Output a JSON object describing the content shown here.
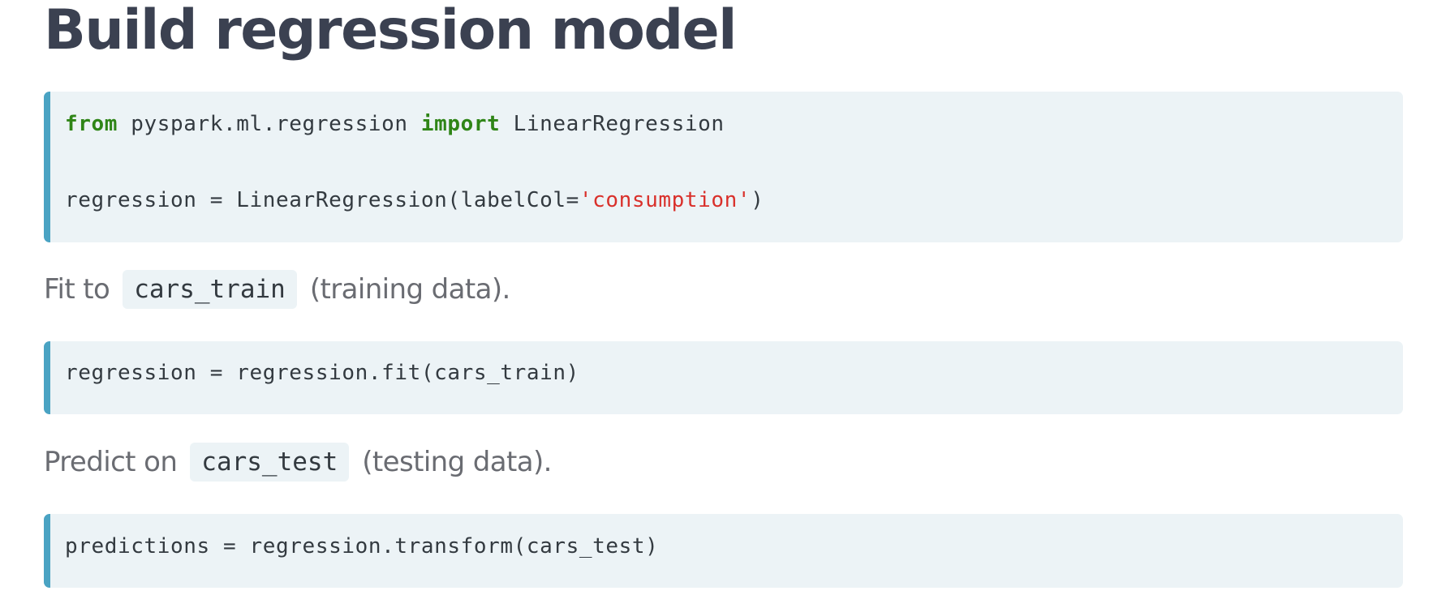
{
  "title": "Build regression model",
  "block1": {
    "line1": {
      "kw1": "from",
      "mod": " pyspark.ml.regression ",
      "kw2": "import",
      "cls": " LinearRegression"
    },
    "line2": {
      "pre": "regression = LinearRegression(labelCol=",
      "str": "'consumption'",
      "post": ")"
    }
  },
  "fit_text": {
    "before": "Fit to",
    "code": "cars_train",
    "after": "(training data)."
  },
  "block2": {
    "line": "regression = regression.fit(cars_train)"
  },
  "predict_text": {
    "before": "Predict on",
    "code": "cars_test",
    "after": "(testing data)."
  },
  "block3": {
    "line": "predictions = regression.transform(cars_test)"
  },
  "colors": {
    "keyword": "#2f8517",
    "string": "#d9302b",
    "code_bg": "#ecf3f6",
    "code_border": "#4aa3c3",
    "heading": "#3b4151"
  }
}
